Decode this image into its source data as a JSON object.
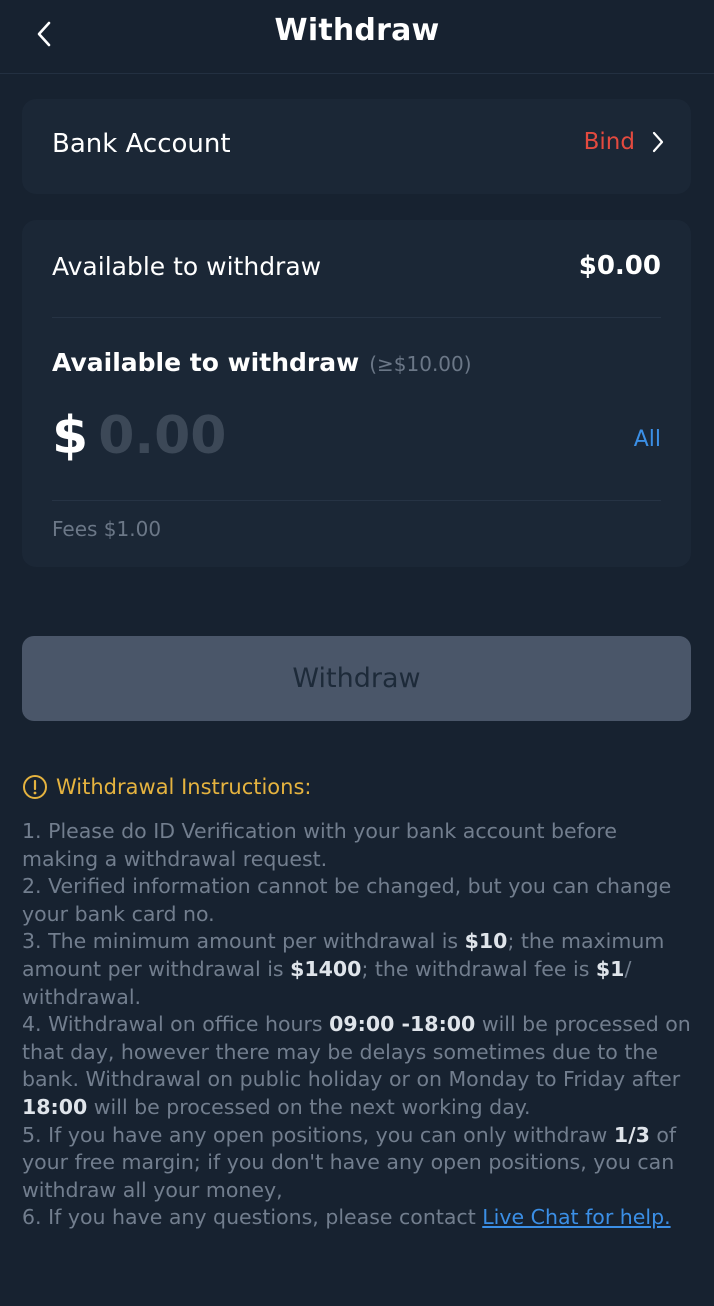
{
  "header": {
    "title": "Withdraw",
    "back_icon": "chevron-left-icon"
  },
  "bank_account": {
    "label": "Bank Account",
    "action_label": "Bind",
    "action_color": "#e34a3f"
  },
  "balance": {
    "label": "Available to withdraw",
    "value": "$0.00"
  },
  "amount_entry": {
    "heading": "Available to withdraw",
    "minimum_note": "(≥$10.00)",
    "currency_symbol": "$",
    "placeholder": "0.00",
    "all_label": "All",
    "fees": "Fees $1.00"
  },
  "withdraw_button": {
    "label": "Withdraw"
  },
  "instructions": {
    "title": "Withdrawal Instructions:",
    "icon": "info-circle-icon",
    "accent_color": "#e5b33f",
    "link_color": "#3b8fe6",
    "items": [
      {
        "parts": [
          "1. Please do ID Verification with your bank account before making a withdrawal request."
        ]
      },
      {
        "parts": [
          "2. Verified information cannot be changed, but you can change your bank card no."
        ]
      },
      {
        "parts": [
          "3. The minimum amount per withdrawal is ",
          "$10",
          "; the maximum amount per withdrawal is ",
          "$1400",
          "; the withdrawal fee is ",
          "$1",
          "/ withdrawal."
        ]
      },
      {
        "parts": [
          "4. Withdrawal on office hours ",
          "09:00 -18:00",
          " will be processed on that day, however there may be delays sometimes due to the bank. Withdrawal on public holiday or on Monday to Friday after ",
          "18:00",
          " will be processed on the next working day."
        ]
      },
      {
        "parts": [
          "5. If you have any open positions, you can only withdraw ",
          "1/3",
          " of your free margin; if you don't have any open positions, you can withdraw all your money,"
        ]
      },
      {
        "parts": [
          "6. If you have any questions, please contact "
        ],
        "link": "Live Chat for help."
      }
    ]
  }
}
